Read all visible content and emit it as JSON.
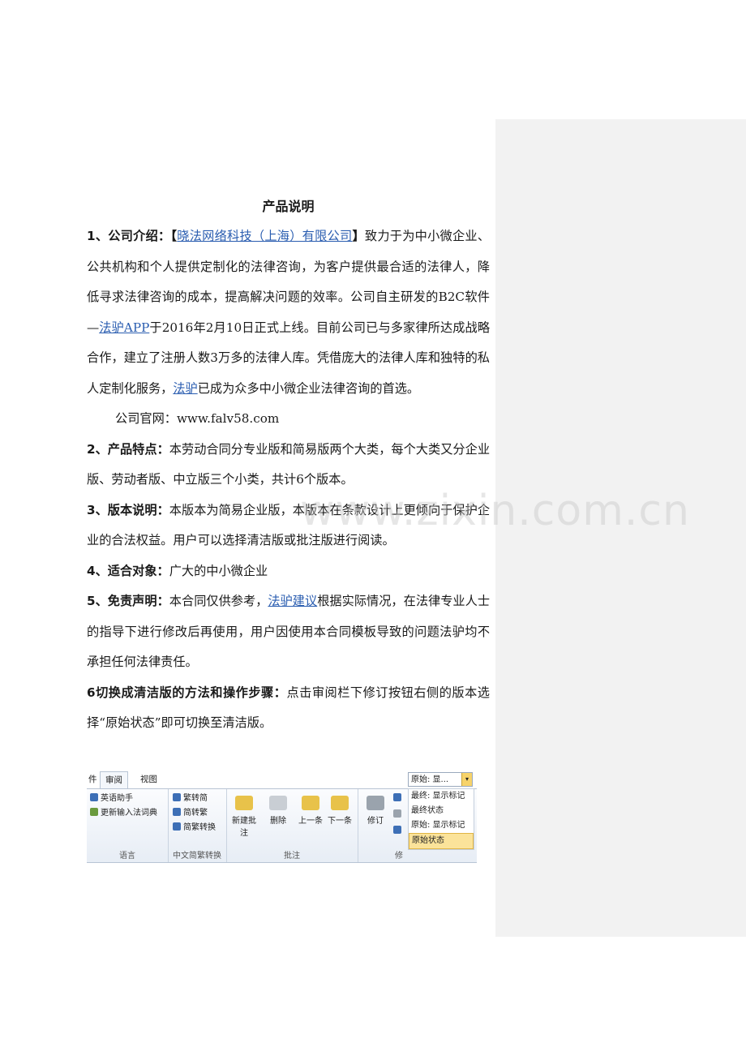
{
  "title": "产品说明",
  "sections": {
    "s1": {
      "label": "1、公司介绍：",
      "open_bracket": "【",
      "company_link": "晓法网络科技（上海）有限公司",
      "close_bracket": "】",
      "text1": "致力于为中小微企业、公共机构和个人提供定制化的法律咨询，为客户提供最合适的法律人，降低寻求法律咨询的成本，提高解决问题的效率。公司自主研发的B2C软件—",
      "app_link": "法驴APP",
      "text2": "于2016年2月10日正式上线。目前公司已与多家律所达成战略合作，建立了注册人数3万多的法律人库。凭借庞大的法律人库和独特的私人定制化服务，",
      "falv_link": "法驴",
      "text3": "已成为众多中小微企业法律咨询的首选。"
    },
    "website": "公司官网：www.falv58.com",
    "s2": {
      "label": "2、产品特点：",
      "text": "本劳动合同分专业版和简易版两个大类，每个大类又分企业版、劳动者版、中立版三个小类，共计6个版本。"
    },
    "s3": {
      "label": "3、版本说明：",
      "text": "本版本为简易企业版，本版本在条款设计上更倾向于保护企业的合法权益。用户可以选择清洁版或批注版进行阅读。"
    },
    "s4": {
      "label": "4、适合对象：",
      "text": "广大的中小微企业"
    },
    "s5": {
      "label": "5、免责声明：",
      "text1": "本合同仅供参考，",
      "link": "法驴建议",
      "text2": "根据实际情况，在法律专业人士的指导下进行修改后再使用，用户因使用本合同模板导致的问题法驴均不承担任何法律责任。"
    },
    "s6": {
      "label": "6切换成清洁版的方法和操作步骤：",
      "text": "点击审阅栏下修订按钮右侧的版本选择“原始状态”即可切换至清洁版。"
    }
  },
  "watermark": "www.zixin.com.cn",
  "ribbon": {
    "tabs": [
      "件",
      "审阅",
      "视图"
    ],
    "language": {
      "items": [
        "英语助手",
        "更新输入法词典"
      ],
      "label": "语言"
    },
    "chinese": {
      "items": [
        "繁转简",
        "简转繁",
        "简繁转换"
      ],
      "label": "中文简繁转换"
    },
    "comments": {
      "buttons": [
        "新建批注",
        "删除",
        "上一条",
        "下一条"
      ],
      "label": "批注"
    },
    "track": {
      "button": "修订",
      "label": "修"
    },
    "dropdown_value": "原始: 显...",
    "menu_items": [
      "最终: 显示标记",
      "最终状态",
      "原始: 显示标记",
      "原始状态"
    ],
    "colors": {
      "folder": "#e8c24a",
      "blue": "#3d6fb6",
      "gray": "#9aa3ad",
      "highlight": "#fbe39a"
    }
  }
}
